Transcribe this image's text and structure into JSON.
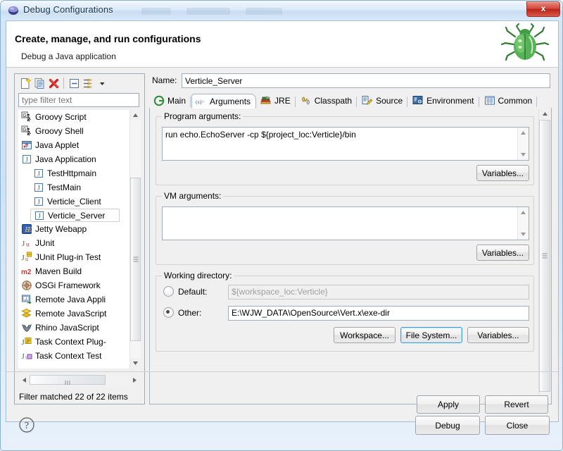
{
  "window": {
    "title": "Debug Configurations",
    "close_label": "x",
    "icon": "eclipse-icon"
  },
  "header": {
    "title": "Create, manage, and run configurations",
    "subtitle": "Debug a Java application",
    "icon": "bug-icon"
  },
  "tree_toolbar": {
    "items": [
      {
        "name": "new-launch-configuration-icon",
        "label": "New launch configuration"
      },
      {
        "name": "duplicate-icon",
        "label": "Duplicates the currently selected launch configuration"
      },
      {
        "name": "delete-icon",
        "label": "Delete selected launch configuration(s)"
      },
      {
        "name": "collapse-all-icon",
        "label": "Collapse All"
      },
      {
        "name": "filter-icon",
        "label": "Filter launch configurations"
      },
      {
        "name": "chevron-down-icon",
        "label": "View Menu"
      }
    ]
  },
  "filter": {
    "placeholder": "type filter text",
    "value": "",
    "status": "Filter matched 22 of 22 items"
  },
  "tree": {
    "items": [
      {
        "label": "Groovy Script",
        "icon": "groovy-script-icon",
        "level": 0,
        "selected": false
      },
      {
        "label": "Groovy Shell",
        "icon": "groovy-shell-icon",
        "level": 0,
        "selected": false
      },
      {
        "label": "Java Applet",
        "icon": "java-applet-icon",
        "level": 0,
        "selected": false
      },
      {
        "label": "Java Application",
        "icon": "java-application-icon",
        "level": 0,
        "selected": false
      },
      {
        "label": "TestHttpmain",
        "icon": "java-launch-icon",
        "level": 1,
        "selected": false
      },
      {
        "label": "TestMain",
        "icon": "java-launch-icon",
        "level": 1,
        "selected": false
      },
      {
        "label": "Verticle_Client",
        "icon": "java-launch-icon",
        "level": 1,
        "selected": false
      },
      {
        "label": "Verticle_Server",
        "icon": "java-launch-icon",
        "level": 1,
        "selected": true
      },
      {
        "label": "Jetty Webapp",
        "icon": "jetty-icon",
        "level": 0,
        "selected": false
      },
      {
        "label": "JUnit",
        "icon": "junit-icon",
        "level": 0,
        "selected": false
      },
      {
        "label": "JUnit Plug-in Test",
        "icon": "junit-plugin-icon",
        "level": 0,
        "selected": false
      },
      {
        "label": "Maven Build",
        "icon": "maven-icon",
        "level": 0,
        "selected": false
      },
      {
        "label": "OSGi Framework",
        "icon": "osgi-icon",
        "level": 0,
        "selected": false
      },
      {
        "label": "Remote Java Appli",
        "icon": "remote-java-icon",
        "level": 0,
        "selected": false
      },
      {
        "label": "Remote JavaScript",
        "icon": "remote-javascript-icon",
        "level": 0,
        "selected": false
      },
      {
        "label": "Rhino JavaScript",
        "icon": "rhino-icon",
        "level": 0,
        "selected": false
      },
      {
        "label": "Task Context Plug-",
        "icon": "task-context-plugin-icon",
        "level": 0,
        "selected": false
      },
      {
        "label": "Task Context Test",
        "icon": "task-context-test-icon",
        "level": 0,
        "selected": false
      }
    ]
  },
  "name_field": {
    "label": "Name:",
    "value": "Verticle_Server"
  },
  "tabs": [
    {
      "label": "Main",
      "icon": "main-tab-icon",
      "selected": false
    },
    {
      "label": "Arguments",
      "icon": "arguments-tab-icon",
      "selected": true
    },
    {
      "label": "JRE",
      "icon": "jre-tab-icon",
      "selected": false
    },
    {
      "label": "Classpath",
      "icon": "classpath-tab-icon",
      "selected": false
    },
    {
      "label": "Source",
      "icon": "source-tab-icon",
      "selected": false
    },
    {
      "label": "Environment",
      "icon": "environment-tab-icon",
      "selected": false
    },
    {
      "label": "Common",
      "icon": "common-tab-icon",
      "selected": false
    }
  ],
  "program_arguments": {
    "group_label": "Program arguments:",
    "value": "run echo.EchoServer -cp ${project_loc:Verticle}/bin",
    "variables_button": "Variables..."
  },
  "vm_arguments": {
    "group_label": "VM arguments:",
    "value": "",
    "variables_button": "Variables..."
  },
  "working_directory": {
    "group_label": "Working directory:",
    "default_label": "Default:",
    "default_value": "${workspace_loc:Verticle}",
    "default_selected": false,
    "other_label": "Other:",
    "other_value": "E:\\WJW_DATA\\OpenSource\\Vert.x\\exe-dir",
    "other_selected": true,
    "workspace_button": "Workspace...",
    "file_system_button": "File System...",
    "variables_button": "Variables..."
  },
  "footer": {
    "apply_label": "Apply",
    "revert_label": "Revert",
    "debug_label": "Debug",
    "close_label": "Close",
    "help_icon": "help-icon"
  },
  "colors": {
    "accent": "#3c9fd6",
    "title_blue": "#16344f",
    "close_red": "#bb2418",
    "delete_red": "#cc2222",
    "dialog_bg": "#f0f0f0"
  }
}
